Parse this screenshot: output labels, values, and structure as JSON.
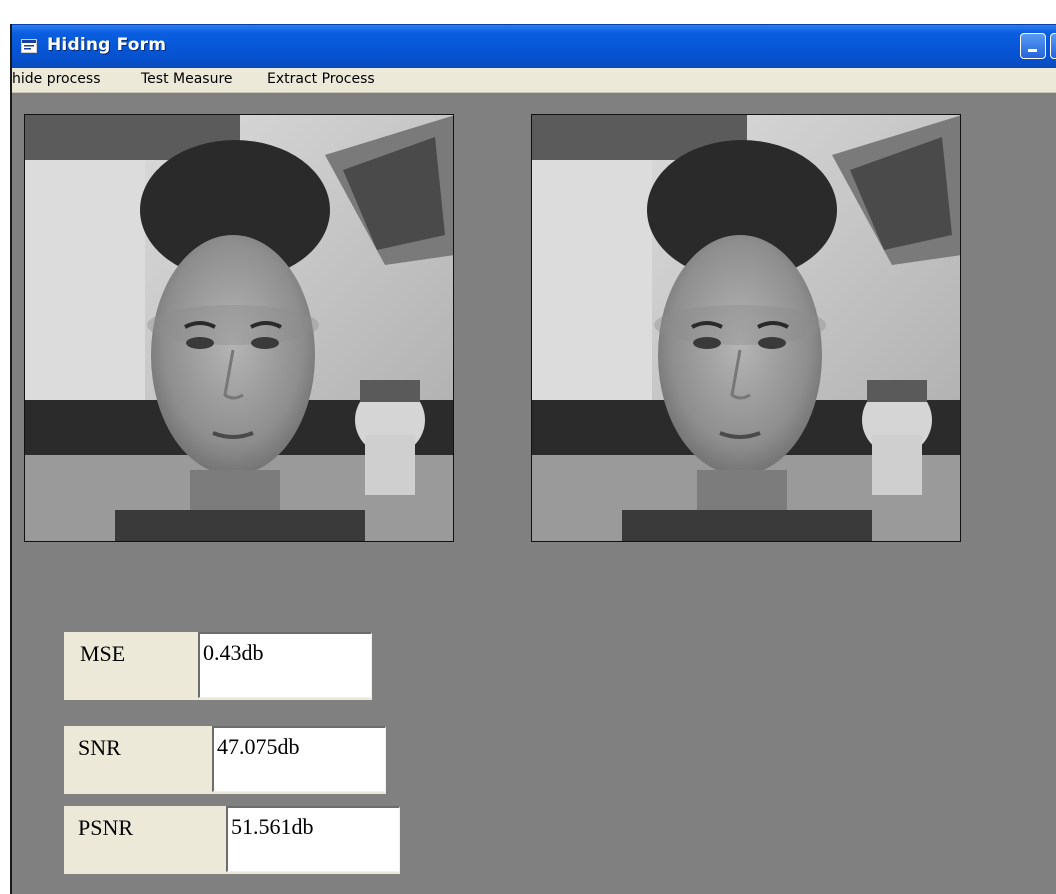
{
  "window": {
    "title": "Hiding Form",
    "icons": {
      "app": "form-app-icon",
      "minimize": "minimize-icon"
    }
  },
  "menu": {
    "items": [
      "hide process",
      "Test Measure",
      "Extract Process"
    ]
  },
  "images": {
    "left": "cover-image-face",
    "right": "stego-image-face"
  },
  "metrics": {
    "mse": {
      "label": "MSE",
      "value": "0.43db"
    },
    "snr": {
      "label": "SNR",
      "value": "47.075db"
    },
    "psnr": {
      "label": "PSNR",
      "value": "51.561db"
    }
  },
  "colors": {
    "titlebar": "#0757d8",
    "client_area": "#808080",
    "menubar": "#ece9d8",
    "textbox": "#ffffff"
  }
}
